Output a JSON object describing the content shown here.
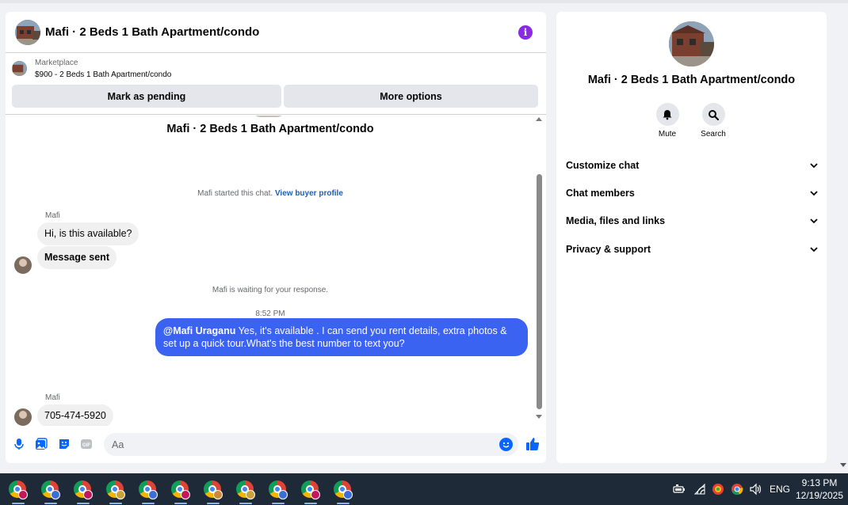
{
  "chat": {
    "header_title": "Mafi · 2 Beds 1 Bath Apartment/condo",
    "info_icon": "info-icon",
    "listing": {
      "source": "Marketplace",
      "price_title": "$900 - 2 Beds 1 Bath Apartment/condo"
    },
    "buttons": {
      "pending": "Mark as pending",
      "more": "More options"
    },
    "conversation_title": "Mafi · 2 Beds 1 Bath Apartment/condo",
    "system_started": "Mafi started this chat.",
    "view_buyer_profile": "View buyer profile",
    "messages": [
      {
        "sender": "Mafi",
        "text": "Hi, is this available?"
      },
      {
        "text": "Message sent"
      }
    ],
    "system_waiting": "Mafi is waiting for your response.",
    "timestamp": "8:52 PM",
    "outgoing": {
      "mention": "@Mafi Uraganu",
      "text": " Yes, it's available .  I can send you rent details, extra photos & set up a quick tour.What's the best number to text you?"
    },
    "reply": {
      "sender": "Mafi",
      "text": "705-474-5920"
    },
    "composer": {
      "placeholder": "Aa",
      "icons": [
        "microphone-icon",
        "photo-icon",
        "sticker-icon",
        "gif-icon",
        "emoji-icon",
        "like-icon"
      ]
    }
  },
  "info_panel": {
    "title": "Mafi · 2 Beds 1 Bath Apartment/condo",
    "actions": [
      {
        "label": "Mute",
        "icon": "bell-icon"
      },
      {
        "label": "Search",
        "icon": "search-icon"
      }
    ],
    "sections": [
      {
        "label": "Customize chat"
      },
      {
        "label": "Chat members"
      },
      {
        "label": "Media, files and links"
      },
      {
        "label": "Privacy & support"
      }
    ]
  },
  "taskbar": {
    "apps_count_label": "chrome profiles",
    "profile_badge_colors": [
      "#c2185b",
      "#3b6fd8",
      "#c2185b",
      "#c9a23a",
      "#3b6fd8",
      "#c2185b",
      "#c98a3a",
      "#c9a23a",
      "#3b6fd8",
      "#c2185b",
      "#3b6fd8"
    ],
    "language": "ENG",
    "time": "9:13 PM",
    "date": "12/19/2025"
  }
}
